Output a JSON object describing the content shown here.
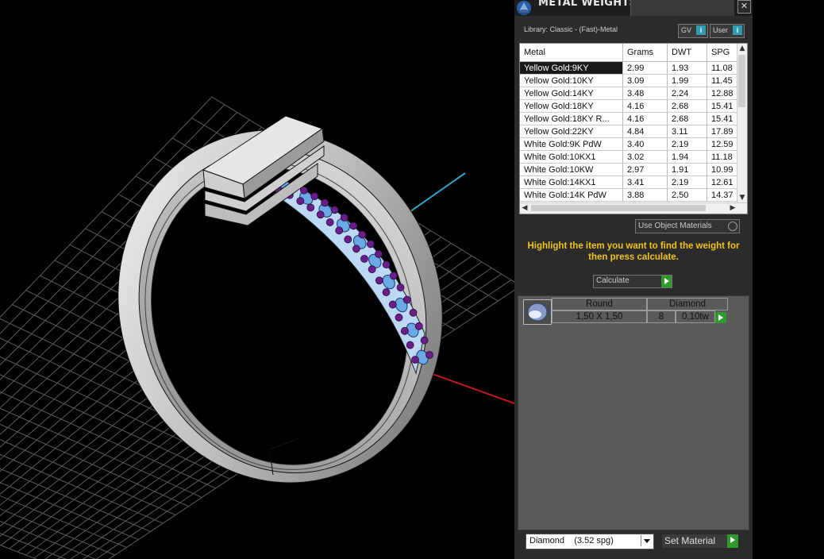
{
  "window": {
    "title": "METAL WEIGHTS",
    "close": "✕"
  },
  "library": {
    "label": "Library: Classic - (Fast)-Metal",
    "gv_label": "GV",
    "user_label": "User",
    "info_glyph": "i"
  },
  "table": {
    "columns": [
      "Metal",
      "Grams",
      "DWT",
      "SPG"
    ],
    "rows": [
      {
        "metal": "Yellow Gold:9KY",
        "grams": "2.99",
        "dwt": "1.93",
        "spg": "11.08"
      },
      {
        "metal": "Yellow Gold:10KY",
        "grams": "3.09",
        "dwt": "1.99",
        "spg": "11.45"
      },
      {
        "metal": "Yellow Gold:14KY",
        "grams": "3.48",
        "dwt": "2.24",
        "spg": "12.88"
      },
      {
        "metal": "Yellow Gold:18KY",
        "grams": "4.16",
        "dwt": "2.68",
        "spg": "15.41"
      },
      {
        "metal": "Yellow Gold:18KY R...",
        "grams": "4.16",
        "dwt": "2.68",
        "spg": "15.41"
      },
      {
        "metal": "Yellow Gold:22KY",
        "grams": "4.84",
        "dwt": "3.11",
        "spg": "17.89"
      },
      {
        "metal": "White Gold:9K PdW",
        "grams": "3.40",
        "dwt": "2.19",
        "spg": "12.59"
      },
      {
        "metal": "White Gold:10KX1",
        "grams": "3.02",
        "dwt": "1.94",
        "spg": "11.18"
      },
      {
        "metal": "White Gold:10KW",
        "grams": "2.97",
        "dwt": "1.91",
        "spg": "10.99"
      },
      {
        "metal": "White Gold:14KX1",
        "grams": "3.41",
        "dwt": "2.19",
        "spg": "12.61"
      },
      {
        "metal": "White Gold:14K PdW",
        "grams": "3.88",
        "dwt": "2.50",
        "spg": "14.37"
      }
    ]
  },
  "use_object_materials": "Use Object Materials",
  "instruction": "Highlight the item you want to find the weight for then press calculate.",
  "calculate_label": "Calculate",
  "stones": {
    "shape": "Round",
    "material": "Diamond",
    "size": "1,50 X 1,50",
    "count": "8",
    "weight": "0,10tw"
  },
  "material_select": "Diamond    (3.52 spg)",
  "set_material_label": "Set Material",
  "colors": {
    "accent": "#f0c419",
    "go": "#2e9a2e",
    "info": "#2f9cb0",
    "gem": "#6aa9e6",
    "prong": "#6a1e8a"
  }
}
